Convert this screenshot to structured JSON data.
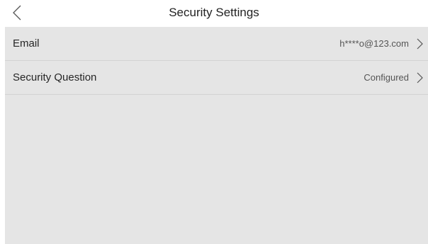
{
  "header": {
    "title": "Security Settings",
    "back_icon": "chevron-left-icon"
  },
  "settings": {
    "items": [
      {
        "label": "Email",
        "value": "h****o@123.com",
        "icon": "chevron-right-icon"
      },
      {
        "label": "Security Question",
        "value": "Configured",
        "icon": "chevron-right-icon"
      }
    ]
  },
  "colors": {
    "background": "#ffffff",
    "panel": "#e5e5e5",
    "divider": "#d2d2d2",
    "text": "#262626",
    "secondary_text": "#555555"
  }
}
